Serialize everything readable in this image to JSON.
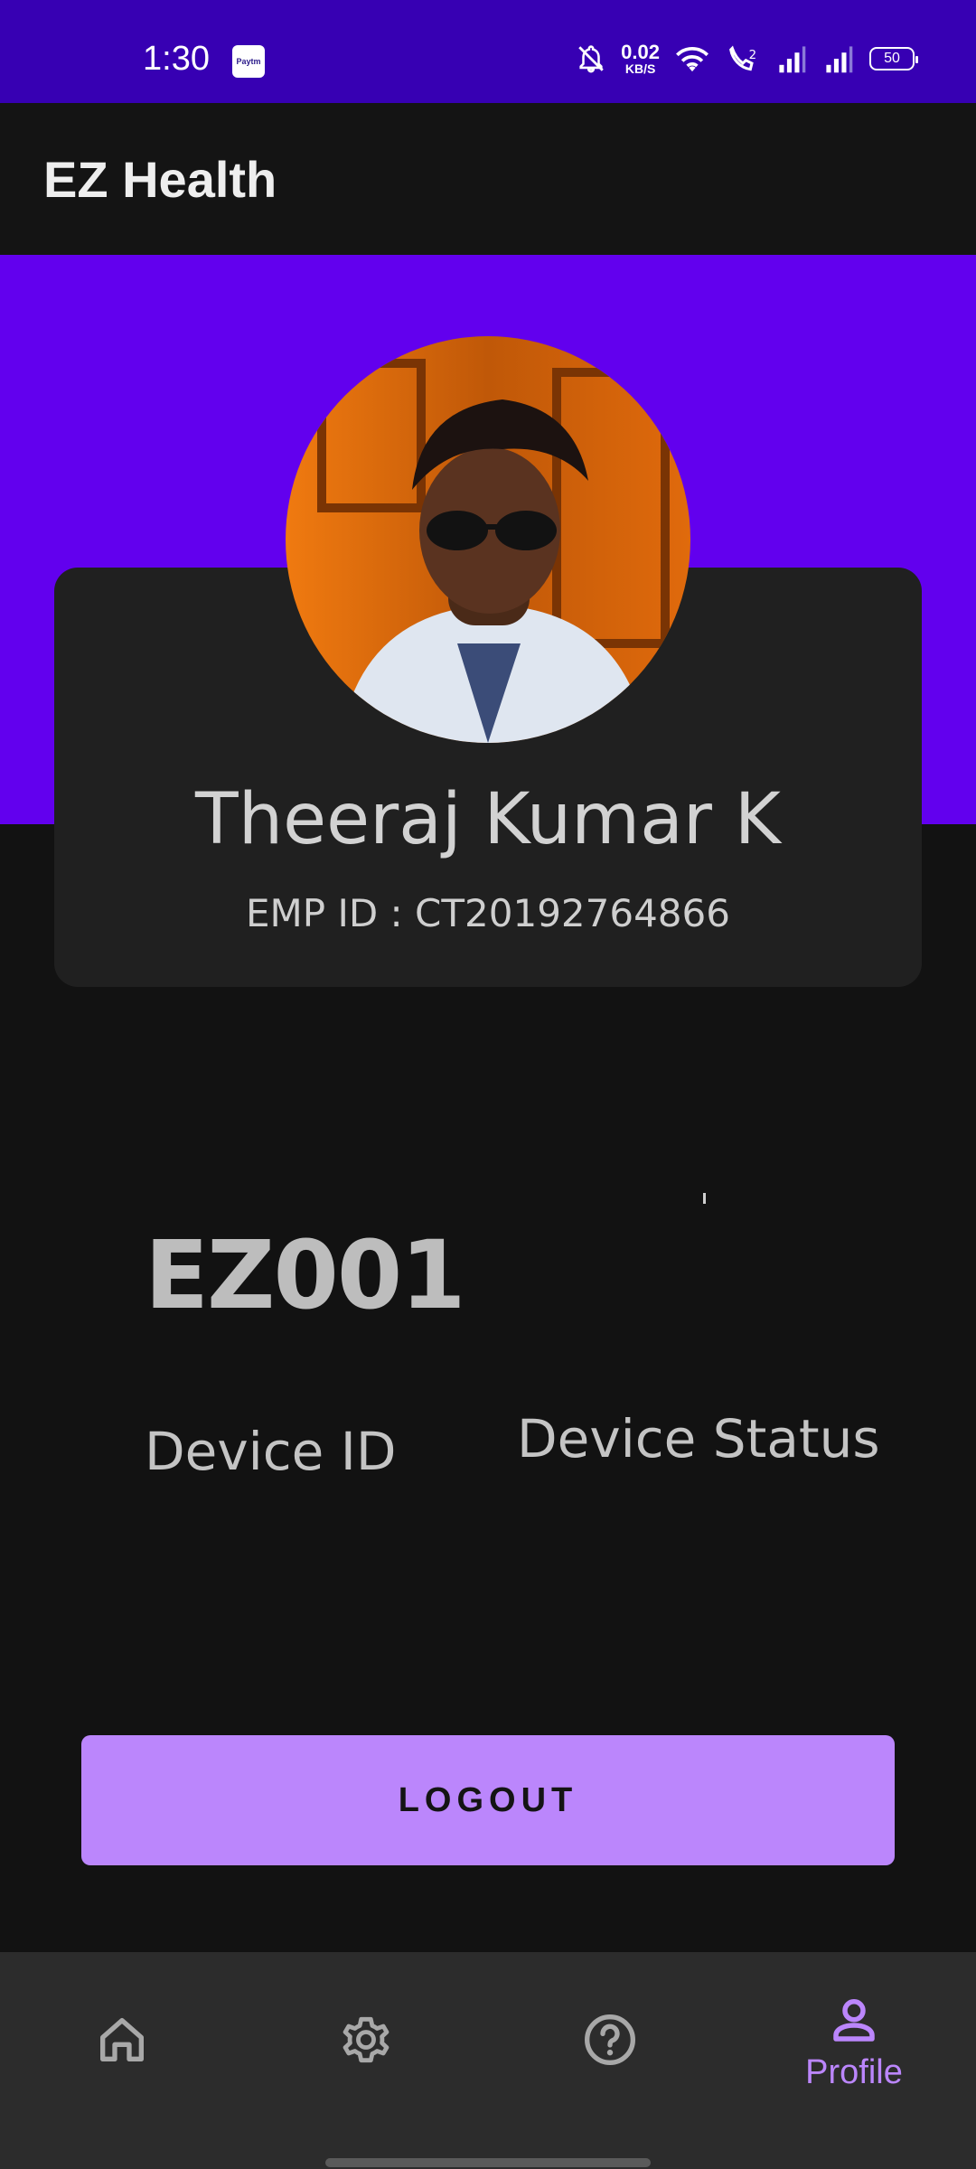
{
  "status_bar": {
    "time": "1:30",
    "paytm_label": "Paytm",
    "network_speed_value": "0.02",
    "network_speed_unit": "KB/S",
    "battery_level": "50",
    "bg_color": "#3700b3"
  },
  "app_bar": {
    "title": "EZ Health"
  },
  "profile": {
    "name": "Theeraj Kumar K",
    "emp_id_label": "EMP ID : ",
    "emp_id": "CT20192764866"
  },
  "device": {
    "id_value": "EZ001",
    "id_label": "Device ID",
    "status_value": "",
    "status_label": "Device Status"
  },
  "actions": {
    "logout_label": "LOGOUT"
  },
  "bottom_nav": {
    "items": [
      {
        "name": "home",
        "icon": "home-icon",
        "label": ""
      },
      {
        "name": "settings",
        "icon": "gear-icon",
        "label": ""
      },
      {
        "name": "help",
        "icon": "help-icon",
        "label": ""
      },
      {
        "name": "profile",
        "icon": "person-icon",
        "label": "Profile",
        "selected": true
      }
    ]
  },
  "colors": {
    "primary": "#6200ee",
    "primary_dark": "#3700b3",
    "accent": "#bb86fc",
    "background": "#121212",
    "card": "#202020",
    "nav_bg": "#2c2c2c"
  }
}
